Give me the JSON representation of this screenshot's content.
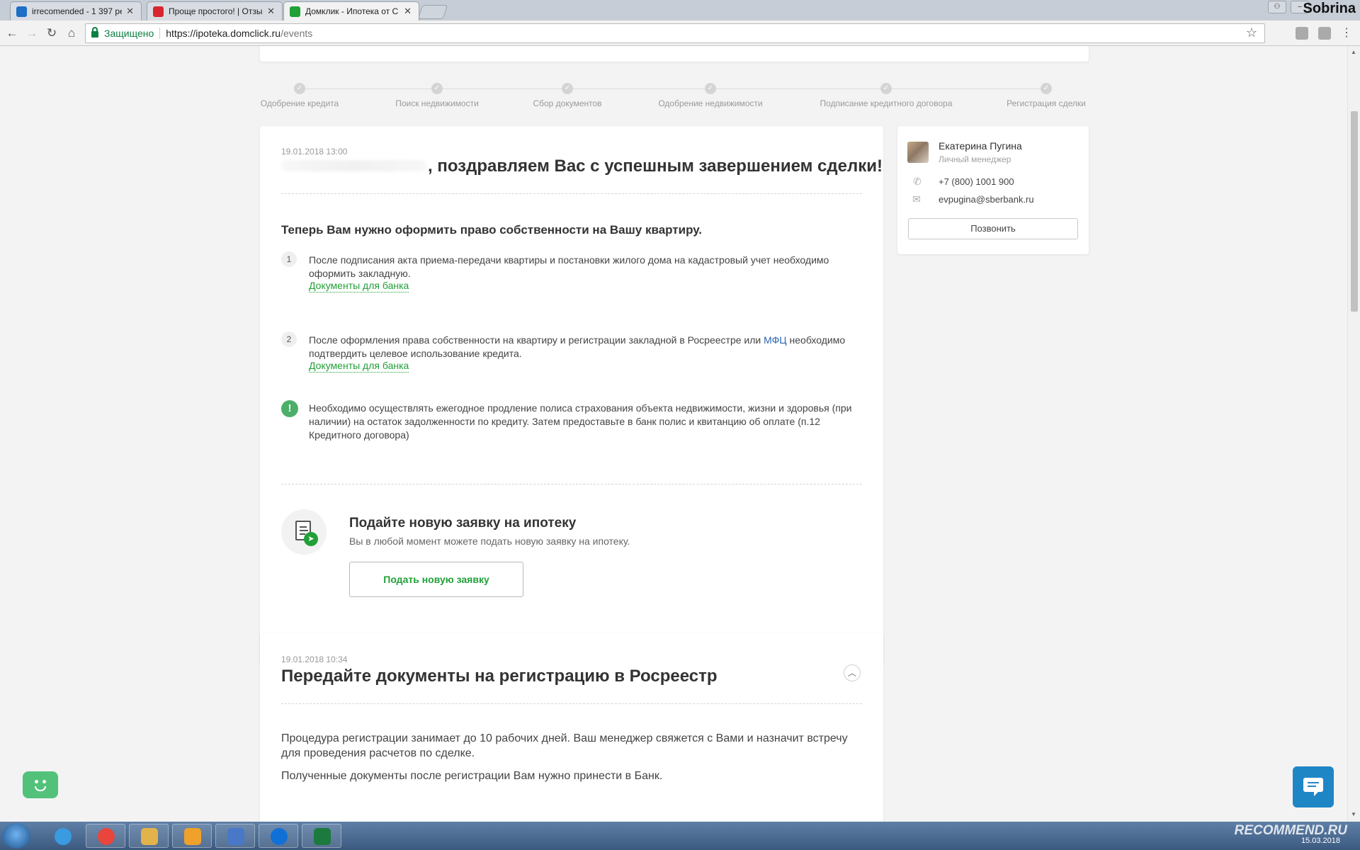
{
  "browser": {
    "tabs": [
      {
        "title": "irrecomended - 1 397 ре",
        "favicon_color": "#1e6fc6"
      },
      {
        "title": "Проще простого! | Отзы",
        "favicon_color": "#d8262f"
      },
      {
        "title": "Домклик - Ипотека от С",
        "favicon_color": "#21a038"
      }
    ],
    "watermark": "Sobrina",
    "secure_label": "Защищено",
    "url_host": "https://ipoteka.domclick.ru",
    "url_path": "/events"
  },
  "steps": [
    "Одобрение кредита",
    "Поиск недвижимости",
    "Сбор документов",
    "Одобрение недвижимости",
    "Подписание кредитного договора",
    "Регистрация сделки"
  ],
  "event1": {
    "timestamp": "19.01.2018  13:00",
    "title": ", поздравляем Вас с успешным завершением сделки!",
    "subheading": "Теперь Вам нужно оформить право собственности на Вашу квартиру.",
    "item1": {
      "number": "1",
      "text": "После подписания акта приема-передачи квартиры и постановки жилого дома на кадастровый учет необходимо оформить закладную.",
      "link": "Документы для банка"
    },
    "item2": {
      "number": "2",
      "text_before": "После оформления права собственности на квартиру и регистрации закладной в Росреестре или ",
      "text_link": "МФЦ",
      "text_after": " необходимо подтвердить целевое использование кредита.",
      "link": "Документы для банка"
    },
    "warning": {
      "icon": "!",
      "text": "Необходимо осуществлять ежегодное продление полиса страхования объекта недвижимости, жизни и здоровья (при наличии) на остаток задолженности по кредиту. Затем предоставьте в банк полис и квитанцию об оплате (п.12 Кредитного договора)"
    },
    "new_application": {
      "title": "Подайте новую заявку на ипотеку",
      "subtitle": "Вы в любой момент можете подать новую заявку на ипотеку.",
      "button": "Подать новую заявку"
    }
  },
  "event2": {
    "timestamp": "19.01.2018  10:34",
    "title": "Передайте документы на регистрацию в Росреестр",
    "p1": "Процедура регистрации занимает до 10 рабочих дней. Ваш менеджер свяжется с Вами и назначит встречу для проведения расчетов по сделке.",
    "p2": "Полученные документы после регистрации Вам нужно принести в Банк."
  },
  "manager": {
    "name": "Екатерина Пугина",
    "role": "Личный менеджер",
    "phone": "+7 (800) 1001 900",
    "email": "evpugina@sberbank.ru",
    "call_button": "Позвонить"
  },
  "taskbar": {
    "date": "15.03.2018",
    "watermark": "RECOMMEND.RU",
    "apps": [
      {
        "name": "chrome",
        "color": "#e8453c"
      },
      {
        "name": "explorer",
        "color": "#e2b34a"
      },
      {
        "name": "outlook",
        "color": "#f0a12b"
      },
      {
        "name": "network",
        "color": "#4a78c9"
      },
      {
        "name": "teamviewer",
        "color": "#1170d6"
      },
      {
        "name": "excel",
        "color": "#1d7a3e"
      }
    ]
  },
  "colors": {
    "accent_green": "#21a038",
    "link_blue": "#2a66b3",
    "chat_blue": "#1f86c6"
  }
}
